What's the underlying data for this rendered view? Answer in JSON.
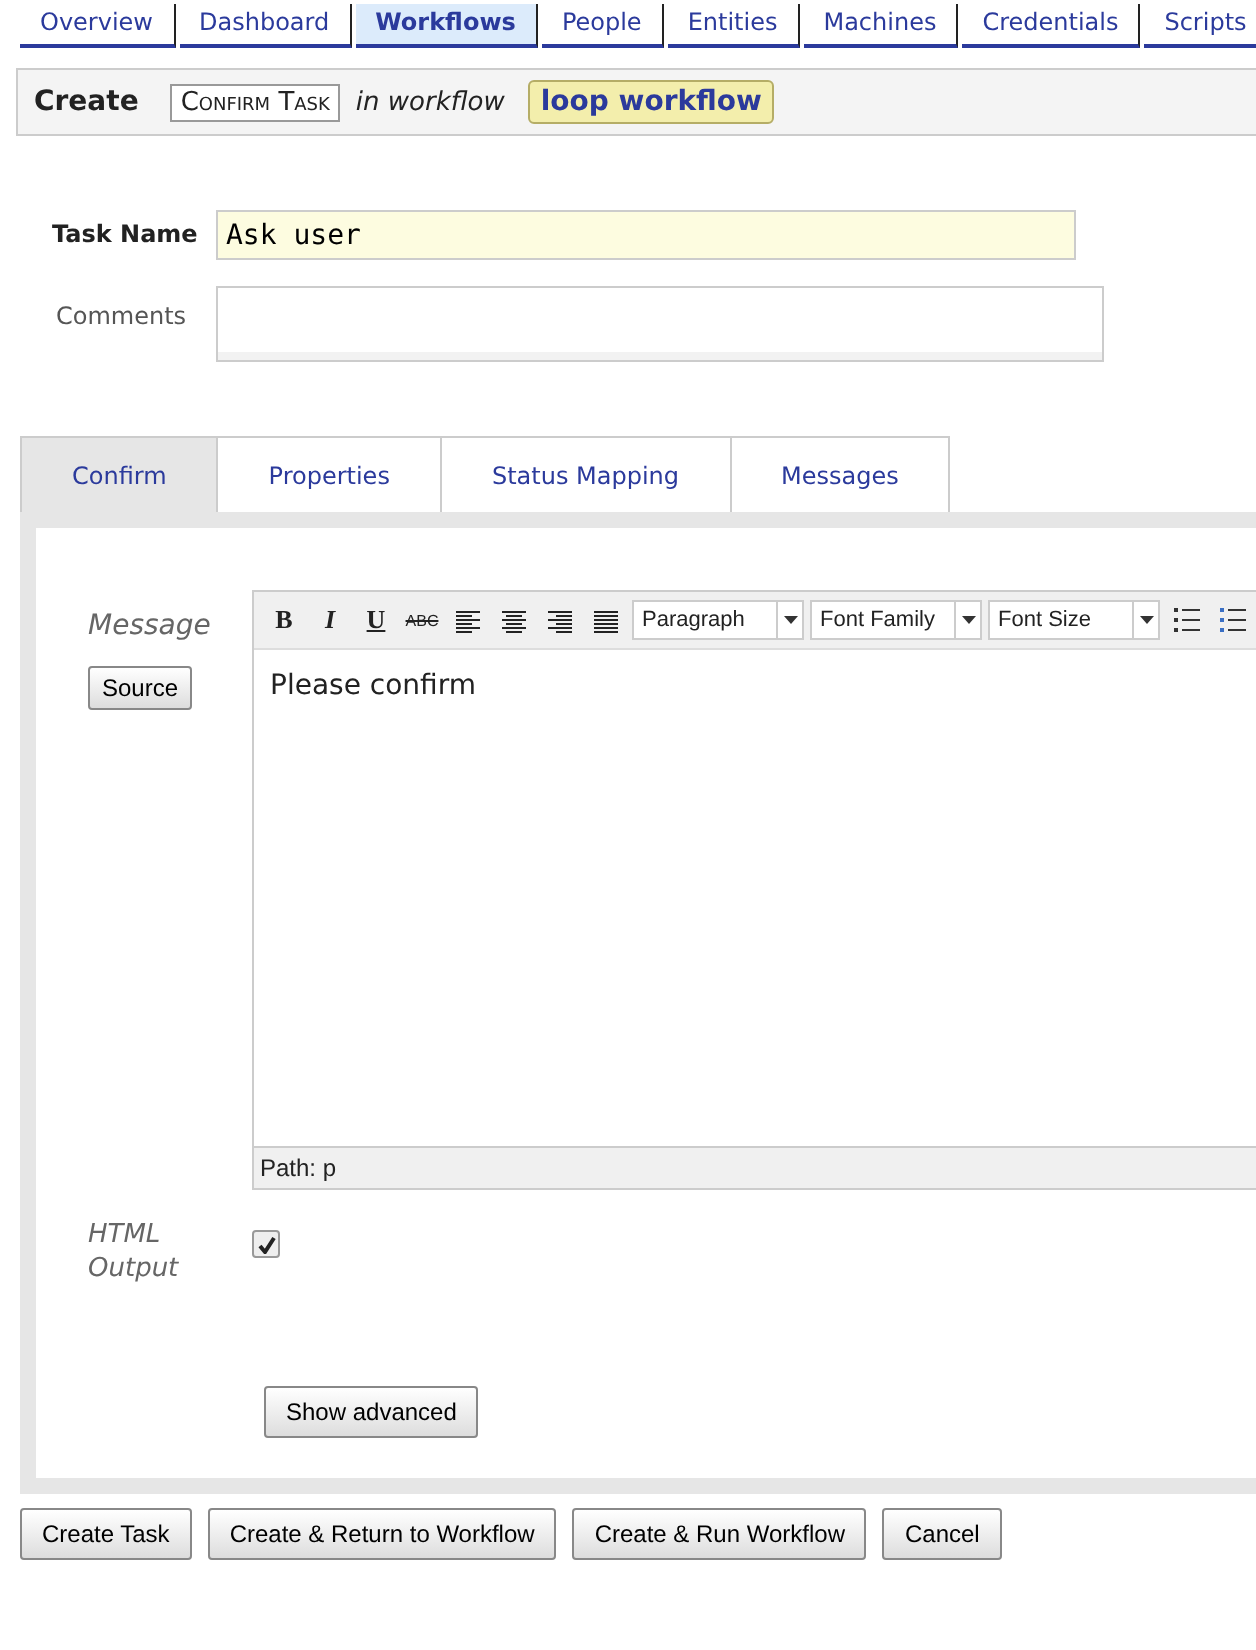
{
  "nav_tabs": [
    {
      "label": "Overview",
      "selected": false
    },
    {
      "label": "Dashboard",
      "selected": false
    },
    {
      "label": "Workflows",
      "selected": true
    },
    {
      "label": "People",
      "selected": false
    },
    {
      "label": "Entities",
      "selected": false
    },
    {
      "label": "Machines",
      "selected": false
    },
    {
      "label": "Credentials",
      "selected": false
    },
    {
      "label": "Scripts",
      "selected": false
    }
  ],
  "header": {
    "title": "Create",
    "task_type": "Confirm Task",
    "connector": "in workflow",
    "workflow": "loop workflow"
  },
  "form": {
    "task_name": {
      "label": "Task Name",
      "value": "Ask user"
    },
    "comments": {
      "label": "Comments"
    }
  },
  "tabs": [
    {
      "label": "Confirm",
      "selected": true
    },
    {
      "label": "Properties",
      "selected": false
    },
    {
      "label": "Status Mapping",
      "selected": false
    },
    {
      "label": "Messages",
      "selected": false
    }
  ],
  "editor": {
    "label": "Message",
    "source_button": "Source",
    "toolbar": [
      {
        "kind": "bold",
        "label": "B"
      },
      {
        "kind": "italic",
        "label": "I"
      },
      {
        "kind": "underline",
        "label": "U"
      },
      {
        "kind": "strike",
        "label": "ABC"
      },
      {
        "kind": "align-left"
      },
      {
        "kind": "align-center"
      },
      {
        "kind": "align-right"
      },
      {
        "kind": "justify"
      },
      {
        "kind": "select",
        "label": "Paragraph"
      },
      {
        "kind": "select",
        "label": "Font Family"
      },
      {
        "kind": "select",
        "label": "Font Size"
      },
      {
        "kind": "bullets"
      },
      {
        "kind": "numbers"
      }
    ],
    "content": "Please confirm",
    "path": "Path: p"
  },
  "html_output": {
    "label": "HTML Output",
    "checked": true
  },
  "show_advanced": "Show advanced",
  "buttons": [
    "Create Task",
    "Create & Return to Workflow",
    "Create & Run Workflow",
    "Cancel"
  ]
}
